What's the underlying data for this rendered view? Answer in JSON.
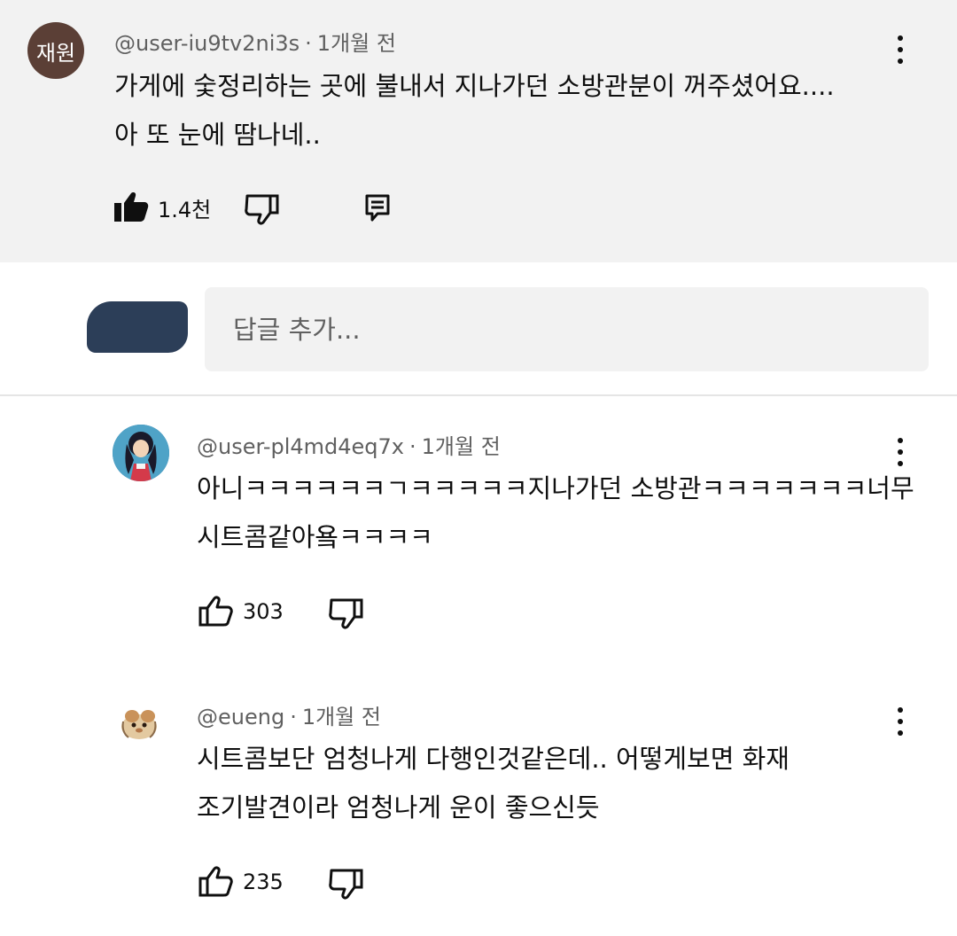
{
  "main_comment": {
    "avatar_text": "재원",
    "username": "@user-iu9tv2ni3s",
    "separator": "·",
    "time": "1개월 전",
    "text_line1": "가게에 숯정리하는 곳에 불내서 지나가던 소방관분이 꺼주셨어요....",
    "text_line2": "아 또 눈에 땀나네..",
    "like_count": "1.4천"
  },
  "reply_box": {
    "placeholder": "답글 추가..."
  },
  "replies": [
    {
      "username": "@user-pl4md4eq7x",
      "separator": "·",
      "time": "1개월 전",
      "text_line1": "아니ㅋㅋㅋㅋㅋㅋㄱㅋㅋㅋㅋㅋ지나가던 소방관ㅋㅋㅋㅋㅋㅋㅋ너무",
      "text_line2": "시트콤같아욬ㅋㅋㅋㅋ",
      "like_count": "303"
    },
    {
      "username": "@eueng",
      "separator": "·",
      "time": "1개월 전",
      "text_line1": "시트콤보단 엄청나게 다행인것같은데.. 어떻게보면 화재",
      "text_line2": "조기발견이라 엄청나게 운이 좋으신듯",
      "like_count": "235"
    }
  ],
  "icons": {
    "like_filled": "thumb-up-filled-icon",
    "like": "thumb-up-icon",
    "dislike": "thumb-down-icon",
    "reply": "comment-icon",
    "more": "more-vert-icon"
  },
  "colors": {
    "highlight_bg": "#f2f2f2",
    "meta_text": "#606060",
    "avatar_bg": "#5b3f36"
  }
}
